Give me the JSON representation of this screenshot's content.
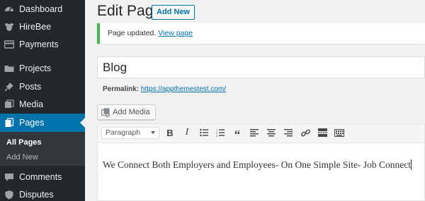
{
  "sidebar": {
    "items": [
      {
        "label": "Dashboard",
        "icon": "dashboard-icon"
      },
      {
        "label": "HireBee",
        "icon": "hirebee-icon"
      },
      {
        "label": "Payments",
        "icon": "payments-icon"
      },
      {
        "label": "Projects",
        "icon": "folder-icon"
      },
      {
        "label": "Posts",
        "icon": "pin-icon"
      },
      {
        "label": "Media",
        "icon": "media-icon"
      },
      {
        "label": "Pages",
        "icon": "pages-icon",
        "active": true
      },
      {
        "label": "Comments",
        "icon": "comments-icon"
      },
      {
        "label": "Disputes",
        "icon": "shield-icon"
      }
    ],
    "submenu": [
      {
        "label": "All Pages",
        "current": true
      },
      {
        "label": "Add New"
      }
    ]
  },
  "header": {
    "title": "Edit Page",
    "add_new_label": "Add New"
  },
  "notice": {
    "text": "Page updated.",
    "link_label": "View page"
  },
  "post": {
    "title": "Blog",
    "permalink_label": "Permalink:",
    "permalink_url": "https://appthemestest.com/"
  },
  "media": {
    "add_media_label": "Add Media"
  },
  "toolbar": {
    "format_value": "Paragraph",
    "buttons": [
      "bold-icon",
      "italic-icon",
      "bullet-list-icon",
      "numbered-list-icon",
      "blockquote-icon",
      "align-left-icon",
      "align-center-icon",
      "align-right-icon",
      "link-icon",
      "read-more-icon",
      "toolbar-toggle-icon"
    ]
  },
  "editor": {
    "content": "We Connect Both Employers and Employees- On One Simple Site- Job Connect"
  },
  "colors": {
    "sidebar_bg": "#23282d",
    "accent": "#0073aa",
    "notice_success": "#46b450"
  }
}
